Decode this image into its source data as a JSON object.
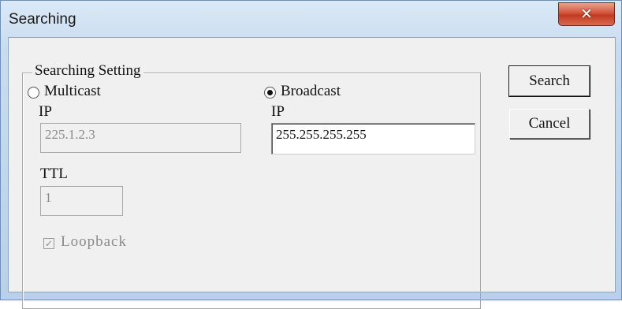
{
  "window": {
    "title": "Searching",
    "close_symbol": "✕"
  },
  "group": {
    "legend": "Searching Setting"
  },
  "multicast": {
    "label": "Multicast",
    "selected": false,
    "ip_label": "IP",
    "ip_value": "225.1.2.3",
    "ttl_label": "TTL",
    "ttl_value": "1",
    "loopback_label": "Loopback",
    "loopback_checked": true
  },
  "broadcast": {
    "label": "Broadcast",
    "selected": true,
    "ip_label": "IP",
    "ip_value": "255.255.255.255"
  },
  "buttons": {
    "search": "Search",
    "cancel": "Cancel"
  },
  "icons": {
    "close": "close-icon",
    "check": "checkmark-icon"
  }
}
